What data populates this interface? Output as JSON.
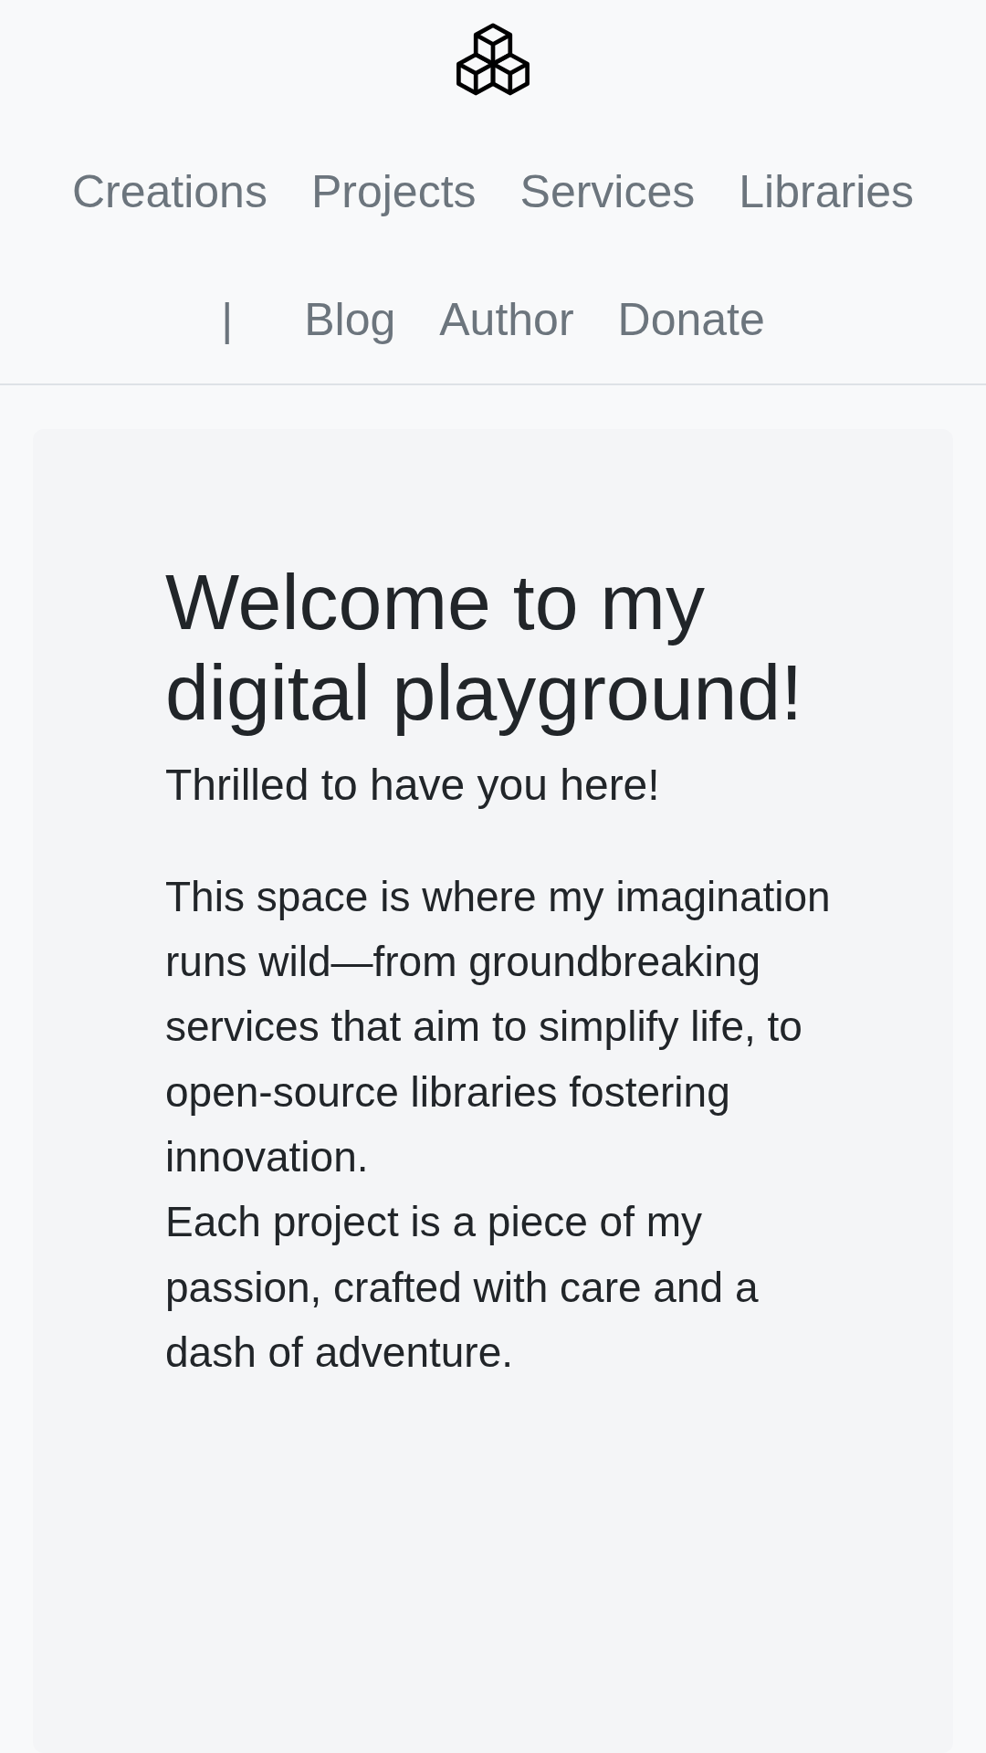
{
  "nav": {
    "rows": [
      {
        "items": [
          {
            "kind": "link",
            "label": "Creations"
          },
          {
            "kind": "link",
            "label": "Projects"
          },
          {
            "kind": "link",
            "label": "Services"
          },
          {
            "kind": "link",
            "label": "Libraries"
          }
        ]
      },
      {
        "items": [
          {
            "kind": "separator",
            "label": "|"
          },
          {
            "kind": "link",
            "label": "Blog"
          },
          {
            "kind": "link",
            "label": "Author"
          },
          {
            "kind": "link",
            "label": "Donate"
          }
        ]
      }
    ]
  },
  "hero": {
    "title": "Welcome to my digital playground!",
    "subtitle": "Thrilled to have you here!",
    "paragraphs": [
      "This space is where my imagination runs wild—from groundbreaking services that aim to simplify life, to open-source libraries fostering innovation.",
      "Each project is a piece of my passion, crafted with care and a dash of adventure."
    ]
  }
}
